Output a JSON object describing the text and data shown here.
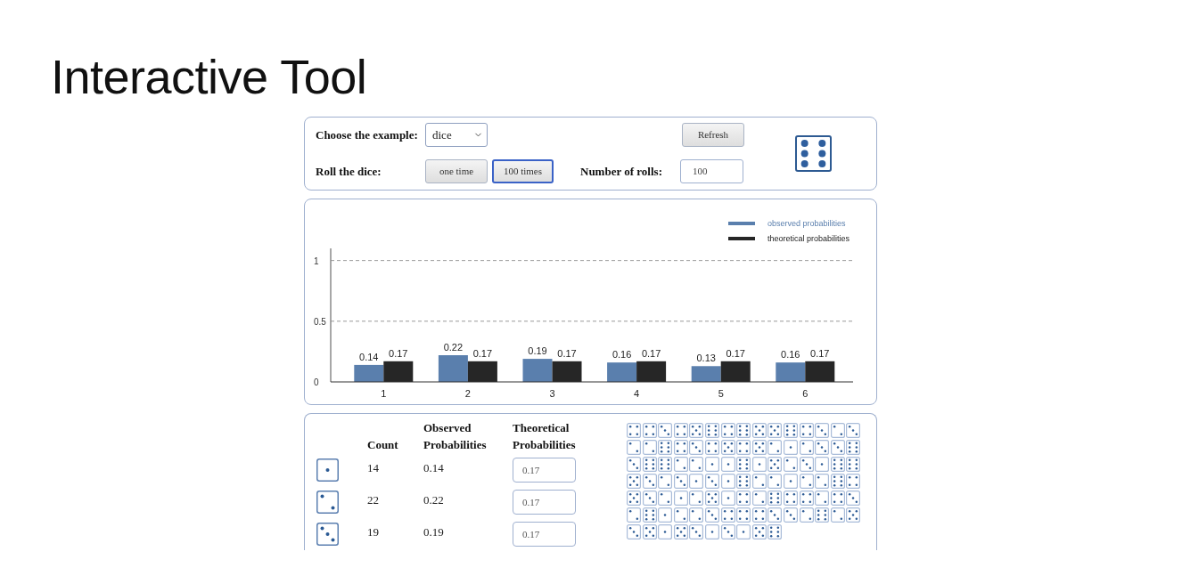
{
  "page": {
    "title": "Interactive Tool"
  },
  "controls": {
    "example_label": "Choose the example:",
    "example_select": {
      "value": "dice"
    },
    "refresh_button": "Refresh",
    "roll_label": "Roll the dice:",
    "roll_buttons": [
      {
        "label": "one time",
        "focused": false
      },
      {
        "label": "100 times",
        "focused": true
      }
    ],
    "rolls_label": "Number of rolls:",
    "rolls_input": {
      "value": "100"
    },
    "die": {
      "kind": "six"
    }
  },
  "chart": {
    "chart_data": {
      "type": "bar",
      "categories": [
        "1",
        "2",
        "3",
        "4",
        "5",
        "6"
      ],
      "series": [
        {
          "name": "observed probabilities",
          "color": "#5a7fad",
          "values": [
            0.14,
            0.22,
            0.19,
            0.16,
            0.13,
            0.16
          ]
        },
        {
          "name": "theoretical probabilities",
          "color": "#262626",
          "values": [
            0.17,
            0.17,
            0.17,
            0.17,
            0.17,
            0.17
          ]
        }
      ],
      "ylim": [
        0,
        1.1
      ],
      "yticks": [
        0,
        0.5,
        1
      ],
      "value_labels": [
        [
          "0.14",
          "0.22",
          "0.19",
          "0.16",
          "0.13",
          "0.16"
        ],
        [
          "0.17",
          "0.17",
          "0.17",
          "0.17",
          "0.17",
          "0.17"
        ]
      ],
      "legend": "upper right"
    }
  },
  "results_table": {
    "columns": [
      "Count",
      "Observed Probabilities",
      "Theoretical Probabilities"
    ],
    "rows": [
      {
        "kind": "one",
        "count": "14",
        "observed": "0.14",
        "theoretical": "0.17"
      },
      {
        "kind": "two",
        "count": "22",
        "observed": "0.22",
        "theoretical": "0.17"
      },
      {
        "kind": "three",
        "count": "19",
        "observed": "0.19",
        "theoretical": "0.17"
      }
    ]
  },
  "roll_history": [
    {
      "kind": "four"
    },
    {
      "kind": "four"
    },
    {
      "kind": "three"
    },
    {
      "kind": "four"
    },
    {
      "kind": "five"
    },
    {
      "kind": "six"
    },
    {
      "kind": "four"
    },
    {
      "kind": "six"
    },
    {
      "kind": "five"
    },
    {
      "kind": "five"
    },
    {
      "kind": "six"
    },
    {
      "kind": "four"
    },
    {
      "kind": "three"
    },
    {
      "kind": "two"
    },
    {
      "kind": "three"
    },
    {
      "kind": "two"
    },
    {
      "kind": "two"
    },
    {
      "kind": "six"
    },
    {
      "kind": "four"
    },
    {
      "kind": "three"
    },
    {
      "kind": "four"
    },
    {
      "kind": "five"
    },
    {
      "kind": "four"
    },
    {
      "kind": "five"
    },
    {
      "kind": "two"
    },
    {
      "kind": "one"
    },
    {
      "kind": "two"
    },
    {
      "kind": "three"
    },
    {
      "kind": "three"
    },
    {
      "kind": "six"
    },
    {
      "kind": "three"
    },
    {
      "kind": "six"
    },
    {
      "kind": "six"
    },
    {
      "kind": "two"
    },
    {
      "kind": "two"
    },
    {
      "kind": "one"
    },
    {
      "kind": "one"
    },
    {
      "kind": "six"
    },
    {
      "kind": "one"
    },
    {
      "kind": "five"
    },
    {
      "kind": "two"
    },
    {
      "kind": "three"
    },
    {
      "kind": "one"
    },
    {
      "kind": "six"
    },
    {
      "kind": "six"
    },
    {
      "kind": "five"
    },
    {
      "kind": "three"
    },
    {
      "kind": "two"
    },
    {
      "kind": "three"
    },
    {
      "kind": "one"
    },
    {
      "kind": "three"
    },
    {
      "kind": "one"
    },
    {
      "kind": "six"
    },
    {
      "kind": "two"
    },
    {
      "kind": "two"
    },
    {
      "kind": "one"
    },
    {
      "kind": "two"
    },
    {
      "kind": "two"
    },
    {
      "kind": "six"
    },
    {
      "kind": "four"
    },
    {
      "kind": "five"
    },
    {
      "kind": "three"
    },
    {
      "kind": "two"
    },
    {
      "kind": "one"
    },
    {
      "kind": "two"
    },
    {
      "kind": "five"
    },
    {
      "kind": "one"
    },
    {
      "kind": "four"
    },
    {
      "kind": "two"
    },
    {
      "kind": "six"
    },
    {
      "kind": "four"
    },
    {
      "kind": "four"
    },
    {
      "kind": "two"
    },
    {
      "kind": "four"
    },
    {
      "kind": "three"
    },
    {
      "kind": "two"
    },
    {
      "kind": "six"
    },
    {
      "kind": "one"
    },
    {
      "kind": "two"
    },
    {
      "kind": "two"
    },
    {
      "kind": "three"
    },
    {
      "kind": "four"
    },
    {
      "kind": "four"
    },
    {
      "kind": "four"
    },
    {
      "kind": "three"
    },
    {
      "kind": "three"
    },
    {
      "kind": "two"
    },
    {
      "kind": "six"
    },
    {
      "kind": "two"
    },
    {
      "kind": "five"
    },
    {
      "kind": "three"
    },
    {
      "kind": "five"
    },
    {
      "kind": "one"
    },
    {
      "kind": "five"
    },
    {
      "kind": "three"
    },
    {
      "kind": "one"
    },
    {
      "kind": "three"
    },
    {
      "kind": "one"
    },
    {
      "kind": "five"
    },
    {
      "kind": "six"
    }
  ]
}
